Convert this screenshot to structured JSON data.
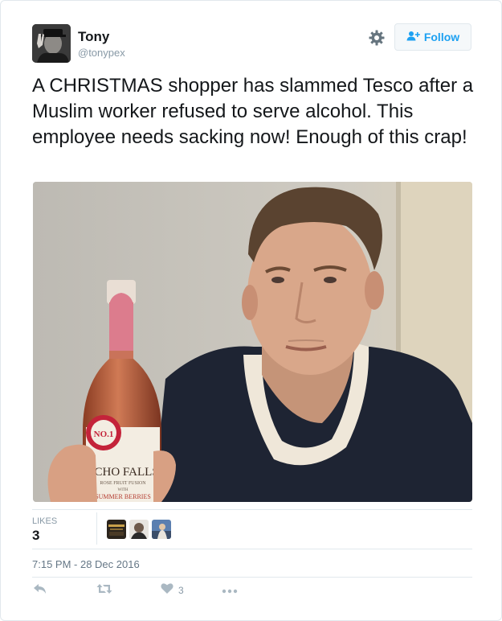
{
  "author": {
    "name": "Tony",
    "handle": "@tonypex"
  },
  "header": {
    "follow_label": "Follow",
    "settings_icon": "gear-icon",
    "follow_icon": "add-user-icon"
  },
  "tweet": {
    "text": "A CHRISTMAS shopper has slammed Tesco after a Muslim worker refused to serve alcohol. This employee needs sacking now! Enough of this crap!"
  },
  "photo": {
    "bottle_label": {
      "badge": "NO.1",
      "brand": "ECHO FALLS",
      "line1": "ROSE FRUIT FUSION",
      "line2": "WITH",
      "line3": "SUMMER BERRIES"
    }
  },
  "stats": {
    "likes_label": "LIKES",
    "likes_count": "3"
  },
  "timestamp": "7:15 PM - 28 Dec 2016",
  "actions": {
    "reply_icon": "reply-icon",
    "retweet_icon": "retweet-icon",
    "like_icon": "heart-icon",
    "like_count": "3",
    "more_icon": "more-icon"
  },
  "colors": {
    "accent": "#1da1f2",
    "text": "#14171a",
    "muted": "#8899a6",
    "border": "#e1e8ed"
  }
}
